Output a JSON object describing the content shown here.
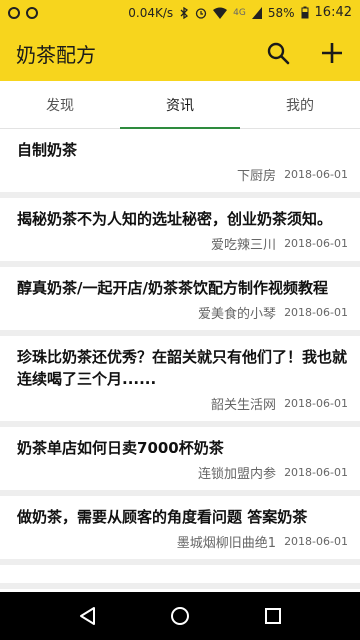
{
  "status_bar": {
    "speed": "0.04K/s",
    "network": "4G",
    "battery": "58%",
    "time": "16:42",
    "icons": [
      "notification-icon",
      "bluetooth-icon",
      "alarm-icon",
      "wifi-icon",
      "signal-icon",
      "battery-icon"
    ]
  },
  "app_bar": {
    "title": "奶茶配方",
    "search_icon": "search-icon",
    "add_icon": "add-icon",
    "accent_color": "#f7d51d"
  },
  "tabs": [
    {
      "label": "发现",
      "active": false
    },
    {
      "label": "资讯",
      "active": true
    },
    {
      "label": "我的",
      "active": false
    }
  ],
  "tab_indicator_color": "#2e8b3d",
  "news": [
    {
      "title": "自制奶茶",
      "source": "下厨房",
      "date": "2018-06-01"
    },
    {
      "title": "揭秘奶茶不为人知的选址秘密，创业奶茶须知。",
      "source": "爱吃辣三川",
      "date": "2018-06-01"
    },
    {
      "title": "醇真奶茶/一起开店/奶茶茶饮配方制作视频教程",
      "source": "爱美食的小琴",
      "date": "2018-06-01"
    },
    {
      "title": "珍珠比奶茶还优秀？在韶关就只有他们了！我也就连续喝了三个月......",
      "source": "韶关生活网",
      "date": "2018-06-01"
    },
    {
      "title": "奶茶单店如何日卖7000杯奶茶",
      "source": "连锁加盟内参",
      "date": "2018-06-01"
    },
    {
      "title": "做奶茶，需要从顾客的角度看问题 答案奶茶",
      "source": "墨城烟柳旧曲绝1",
      "date": "2018-06-01"
    },
    {
      "title": "",
      "source": "",
      "date": ""
    }
  ],
  "nav_bar": {
    "back_icon": "back-icon",
    "home_icon": "home-icon",
    "recents_icon": "recents-icon"
  }
}
